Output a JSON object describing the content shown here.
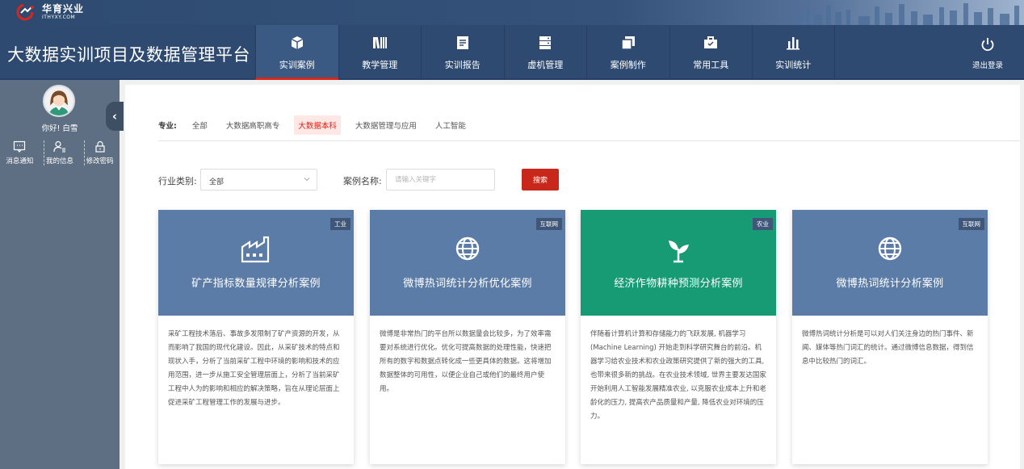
{
  "brand": {
    "name_cn": "华育兴业",
    "name_en": "ITHYXY.COM"
  },
  "app_title": "大数据实训项目及数据管理平台",
  "nav": [
    {
      "label": "实训案例",
      "icon": "cube-icon",
      "active": true
    },
    {
      "label": "教学管理",
      "icon": "books-icon",
      "active": false
    },
    {
      "label": "实训报告",
      "icon": "report-icon",
      "active": false
    },
    {
      "label": "虚机管理",
      "icon": "server-icon",
      "active": false
    },
    {
      "label": "案例制作",
      "icon": "case-make-icon",
      "active": false
    },
    {
      "label": "常用工具",
      "icon": "toolbox-icon",
      "active": false
    },
    {
      "label": "实训统计",
      "icon": "bar-chart-icon",
      "active": false
    }
  ],
  "logout_label": "退出登录",
  "sidebar": {
    "greeting": "你好! 白雪",
    "actions": [
      {
        "label": "消息通知",
        "icon": "message-icon"
      },
      {
        "label": "我的信息",
        "icon": "user-list-icon"
      },
      {
        "label": "修改密码",
        "icon": "lock-icon"
      }
    ]
  },
  "filter": {
    "key": "专业:",
    "options": [
      "全部",
      "大数据高职高专",
      "大数据本科",
      "大数据管理与应用",
      "人工智能"
    ],
    "selected": "大数据本科"
  },
  "search": {
    "industry_label": "行业类别:",
    "industry_value": "全部",
    "name_label": "案例名称:",
    "name_placeholder": "请输入关键字",
    "button": "搜索"
  },
  "colors": {
    "blue": "#5b7ca7",
    "green": "#169b74",
    "nav_active_underline": "#d9261c",
    "accent": "#c8281b"
  },
  "cards": [
    {
      "tag": "工业",
      "icon": "factory-icon",
      "color": "#5b7ca7",
      "title": "矿产指标数量规律分析案例",
      "desc": "采矿工程技术落后、事故多发限制了矿产资源的开发，从而影响了我国的现代化建设。因此，从采矿技术的特点和现状入手，分析了当前采矿工程中环境的影响和技术的应用范围，进一步从施工安全管理层面上，分析了当前采矿工程中人为的影响和相应的解决策略，旨在从理论层面上促进采矿工程管理工作的发展与进步。"
    },
    {
      "tag": "互联网",
      "icon": "globe-icon",
      "color": "#5b7ca7",
      "title": "微博热词统计分析优化案例",
      "desc": "微博是非常热门的平台所以数据量会比较多，为了效率需要对系统进行优化。优化可提高数据的处理性能，快速把所有的数字和数据点转化成一些更具体的数据。这将增加数据整体的可用性，以便企业自己或他们的最终用户使用。"
    },
    {
      "tag": "农业",
      "icon": "sprout-icon",
      "color": "#169b74",
      "title": "经济作物耕种预测分析案例",
      "desc": "伴随着计算机计算和存储能力的飞跃发展, 机器学习(Machine Learning) 开始走到科学研究舞台的前沿。机器学习给农业技术和农业政策研究提供了新的强大的工具, 也带来很多新的挑战。在农业技术领域, 世界主要发达国家开始利用人工智能发展精准农业, 以克服农业成本上升和老龄化的压力, 提高农产品质量和产量, 降低农业对环境的压力。"
    },
    {
      "tag": "互联网",
      "icon": "globe-icon",
      "color": "#5b7ca7",
      "title": "微博热词统计分析案例",
      "desc": "微博热词统计分析是可以对人们关注身边的热门事件、新闻、媒体等热门词汇的统计。通过微博信息数据，得到信息中比较热门的词汇。"
    }
  ]
}
